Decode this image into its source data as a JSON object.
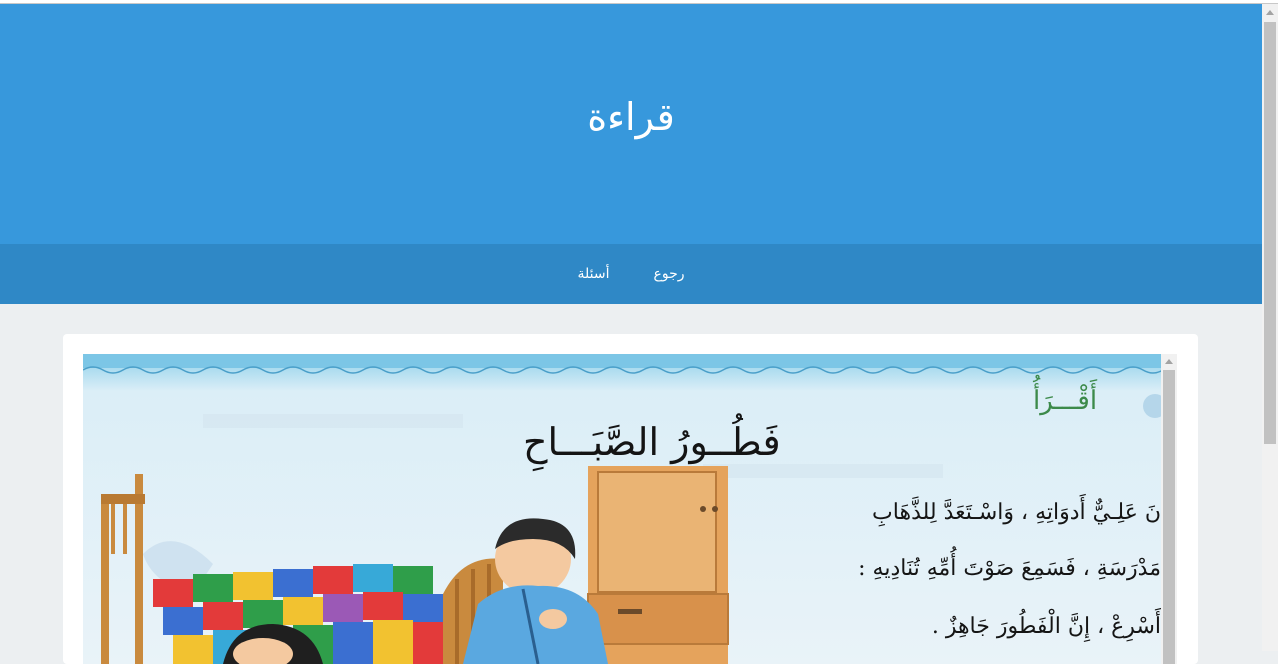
{
  "header": {
    "title": "قراءة"
  },
  "nav": {
    "items": [
      {
        "label": "رجوع"
      },
      {
        "label": "أسئلة"
      }
    ]
  },
  "content": {
    "image": {
      "lesson_tag": "أَقْـــرَأُ",
      "story_title": "فَطُــورُ الصَّبَـــاحِ",
      "lines": [
        "نَ عَلِـيٌّ أَدوَاتِهِ ، وَاسْـتَعَدَّ لِلذَّهَابِ",
        "مَدْرَسَةِ ، فَسَمِعَ صَوْتَ أُمِّهِ تُنَادِيهِ :",
        "أَسْرِعْ ، إِنَّ الْفَطُورَ جَاهِزٌ ."
      ]
    }
  },
  "colors": {
    "header_bg": "#3798dc",
    "nav_bg": "#2f88c6",
    "page_bg": "#eceff1"
  }
}
